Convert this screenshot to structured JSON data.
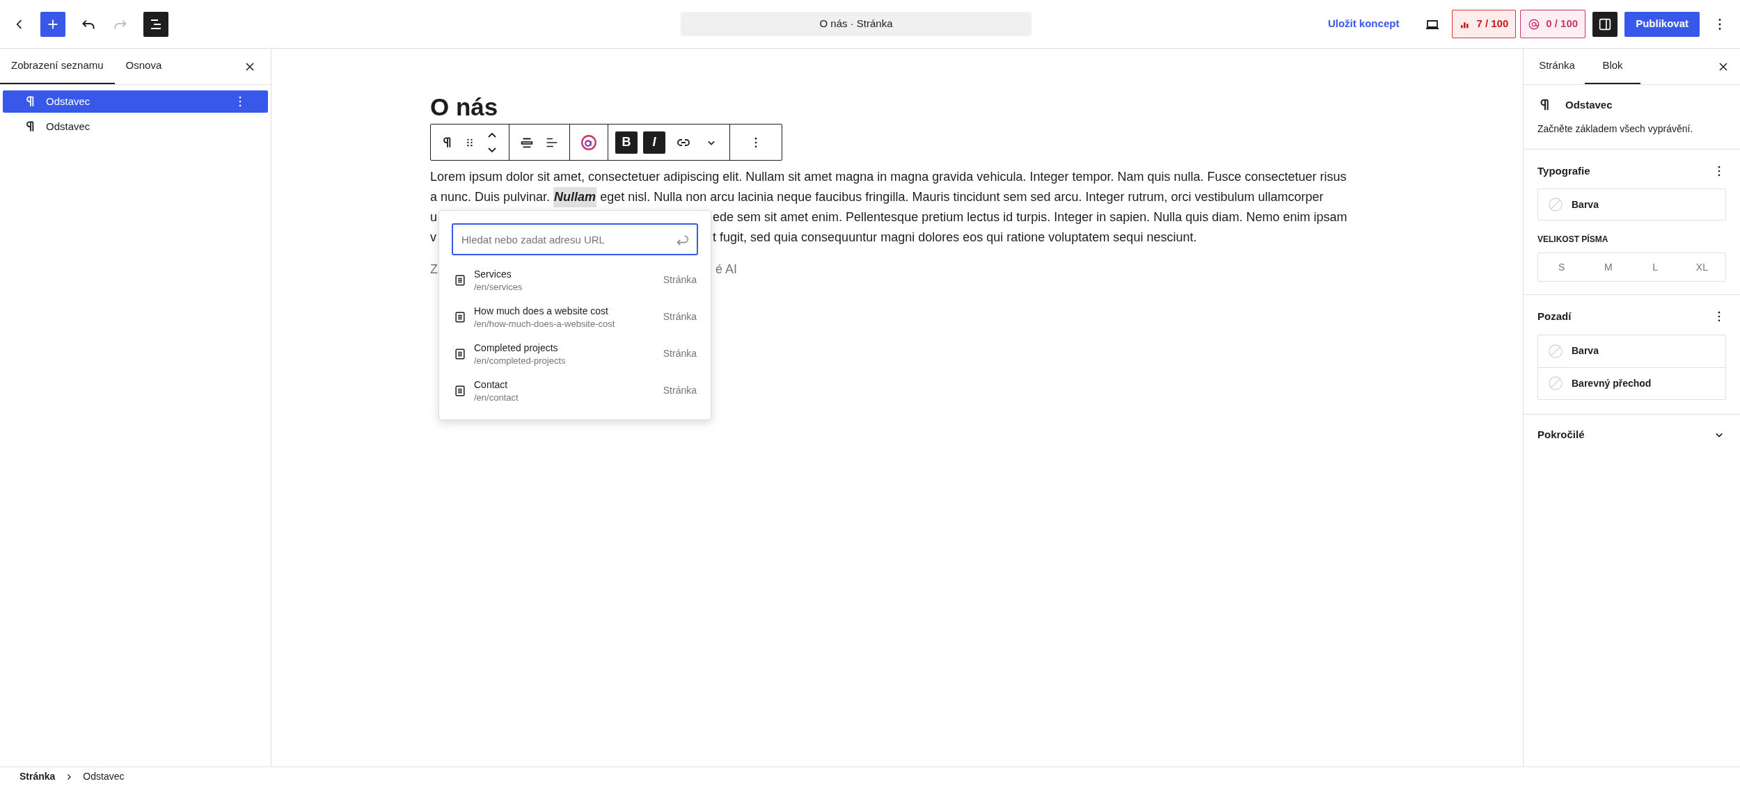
{
  "top_bar": {
    "redo": {
      "disabled": true
    },
    "page_title": "O nás · Stránka",
    "save_draft": "Uložit koncept",
    "seo_score": "7 / 100",
    "ai_score": "0 / 100",
    "publish": "Publikovat"
  },
  "left_panel": {
    "tabs": [
      {
        "label": "Zobrazení seznamu",
        "selected": true
      },
      {
        "label": "Osnova",
        "selected": false
      }
    ],
    "items": [
      {
        "label": "Odstavec",
        "selected": true
      },
      {
        "label": "Odstavec",
        "selected": false
      }
    ]
  },
  "editor": {
    "heading": "O nás",
    "block_toolbar": {
      "bold": {
        "label": "B",
        "active": true
      },
      "italic": {
        "label": "I",
        "active": true
      }
    },
    "paragraph_lines": [
      {
        "kind": "full",
        "text": "Lorem ipsum dolor sit amet, consectetuer adipiscing elit. Nullam sit amet magna in magna gravida vehicula. Integer tempor. Nam quis nulla. Fusce consectetuer risus"
      },
      {
        "kind": "selection",
        "before": "a nunc. Duis pulvinar.",
        "selected_word": "Nullam",
        "after": "eget nisl. Nulla non arcu lacinia neque faucibus fringilla. Mauris tincidunt sem sed arcu. Integer rutrum, orci vestibulum ullamcorper"
      },
      {
        "kind": "covered",
        "left": "u",
        "right": "ede sem sit amet enim. Pellentesque pretium lectus id turpis. Integer in sapien. Nulla quis diam. Nemo enim ipsam"
      },
      {
        "kind": "covered",
        "left": "v",
        "right": "t fugit, sed quia consequuntur magni dolores eos qui ratione voluptatem sequi nesciunt."
      }
    ],
    "second_paragraph": {
      "left": "Z",
      "right": "é AI"
    },
    "link_popover": {
      "placeholder": "Hledat nebo zadat adresu URL",
      "suggestions": [
        {
          "title": "Services",
          "url": "/en/services",
          "type": "Stránka"
        },
        {
          "title": "How much does a website cost",
          "url": "/en/how-much-does-a-website-cost",
          "type": "Stránka"
        },
        {
          "title": "Completed projects",
          "url": "/en/completed-projects",
          "type": "Stránka"
        },
        {
          "title": "Contact",
          "url": "/en/contact",
          "type": "Stránka"
        }
      ]
    }
  },
  "right_panel": {
    "tabs": [
      {
        "label": "Stránka",
        "selected": false
      },
      {
        "label": "Blok",
        "selected": true
      }
    ],
    "block": {
      "name": "Odstavec",
      "description": "Začněte základem všech vyprávění."
    },
    "typography": {
      "title": "Typografie",
      "color_label": "Barva",
      "font_size_label": "VELIKOST PÍSMA",
      "sizes": [
        "S",
        "M",
        "L",
        "XL"
      ]
    },
    "background": {
      "title": "Pozadí",
      "options": [
        "Barva",
        "Barevný přechod"
      ]
    },
    "advanced": {
      "title": "Pokročilé",
      "expanded": false
    }
  },
  "breadcrumb": [
    "Stránka",
    "Odstavec"
  ]
}
